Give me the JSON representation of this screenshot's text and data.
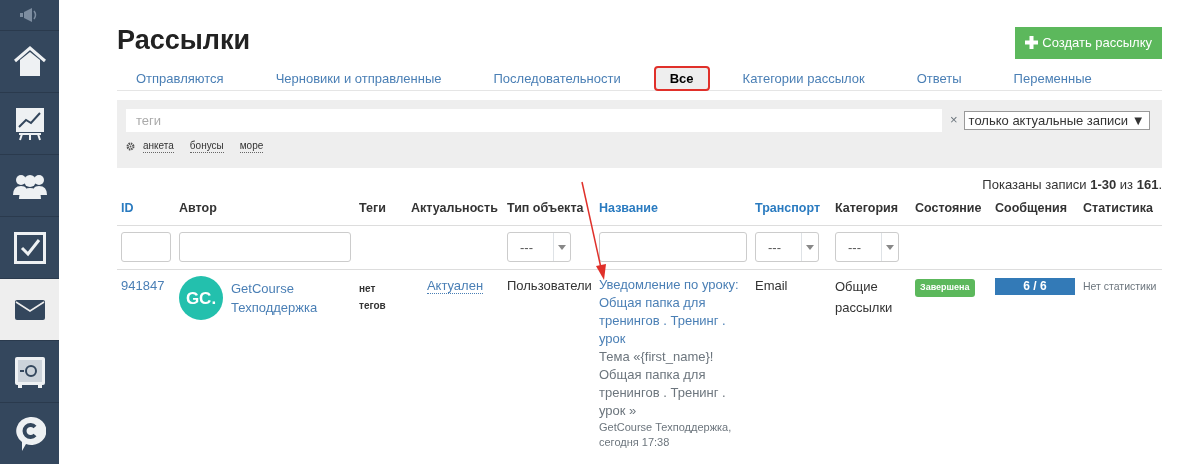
{
  "sidebar": {
    "items": [
      {
        "selected": false
      },
      {
        "selected": false
      },
      {
        "selected": false
      },
      {
        "selected": false
      },
      {
        "selected": false
      },
      {
        "selected": true
      },
      {
        "selected": false
      },
      {
        "selected": false
      }
    ]
  },
  "page": {
    "title": "Рассылки",
    "create_button": "Создать рассылку"
  },
  "tabs": [
    {
      "label": "Отправляются",
      "selected": false
    },
    {
      "label": "Черновики и отправленные",
      "selected": false
    },
    {
      "label": "Последовательности",
      "selected": false
    },
    {
      "label": "Все",
      "selected": true
    },
    {
      "label": "Категории рассылок",
      "selected": false
    },
    {
      "label": "Ответы",
      "selected": false
    },
    {
      "label": "Переменные",
      "selected": false
    }
  ],
  "filter": {
    "tags_placeholder": "теги",
    "clear": "×",
    "select_value": "только актуальные записи",
    "select_arrow": "▼",
    "tag_links": [
      "анкета",
      "бонусы",
      "море"
    ]
  },
  "summary": "Показаны записи **1-30** из **161**.",
  "table": {
    "columns": [
      {
        "label": "ID",
        "sortable": true,
        "filter": {
          "kind": "input"
        }
      },
      {
        "label": "Автор",
        "sortable": false,
        "filter": {
          "kind": "input"
        }
      },
      {
        "label": "Теги",
        "sortable": false,
        "filter": {
          "kind": "none"
        }
      },
      {
        "label": "Актуальность",
        "sortable": false,
        "filter": {
          "kind": "none"
        }
      },
      {
        "label": "Тип объекта",
        "sortable": false,
        "filter": {
          "kind": "select",
          "value": "---"
        }
      },
      {
        "label": "Название",
        "sortable": true,
        "filter": {
          "kind": "input"
        }
      },
      {
        "label": "Транспорт",
        "sortable": true,
        "filter": {
          "kind": "select",
          "value": "---"
        }
      },
      {
        "label": "Категория",
        "sortable": false,
        "filter": {
          "kind": "select",
          "value": "---"
        }
      },
      {
        "label": "Состояние",
        "sortable": false,
        "filter": {
          "kind": "none"
        }
      },
      {
        "label": "Сообщения",
        "sortable": false,
        "filter": {
          "kind": "none"
        }
      },
      {
        "label": "Статистика",
        "sortable": false,
        "filter": {
          "kind": "none"
        }
      }
    ],
    "rows": [
      {
        "id": "941847",
        "avatar_text": "GC.",
        "author": "GetCourse Техподдержка",
        "tags": "нет тегов",
        "actuality": "Актуален",
        "object_type": "Пользователи",
        "title": "Уведомление по уроку: Общая папка для тренингов . Тренинг . урок",
        "subject": "Тема «{first_name}! Общая папка для тренингов . Тренинг . урок »",
        "meta": "GetCourse Техподдержка, сегодня 17:38",
        "transport": "Email",
        "category": "Общие рассылки",
        "status": "Завершена",
        "messages": {
          "text": "6 / 6",
          "level": 1
        },
        "statistics": "Нет статистики"
      }
    ]
  }
}
